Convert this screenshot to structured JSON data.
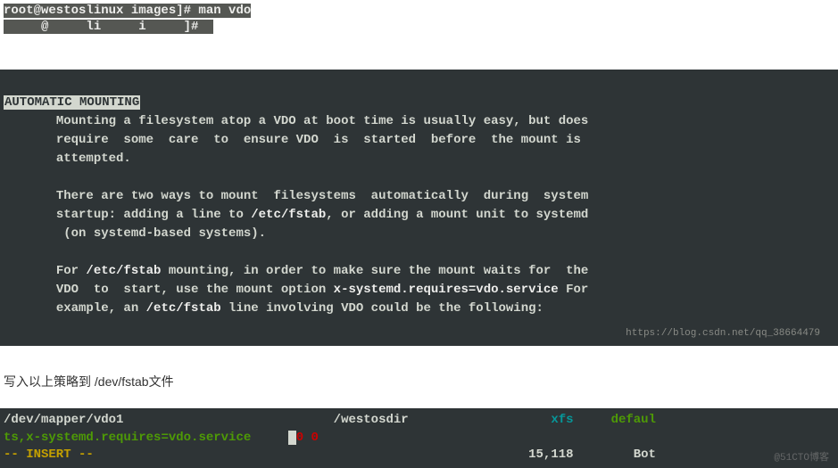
{
  "top": {
    "prompt": "root@westoslinux images]# man vdo",
    "second": "     @     li     i     ]#  "
  },
  "man": {
    "heading": "AUTOMATIC MOUNTING",
    "para1_l1": "       Mounting a filesystem atop a VDO at boot time is usually easy, but does",
    "para1_l2": "       require  some  care  to  ensure VDO  is  started  before  the mount is",
    "para1_l3": "       attempted.",
    "para2_l1": "       There are two ways to mount  filesystems  automatically  during  system",
    "para2_l2a": "       startup: adding a line to ",
    "path_fstab": "/etc/fstab",
    "para2_l2b": ", or adding a mount unit to systemd",
    "para2_l3": "        (on systemd-based systems).",
    "para3_l1a": "       For ",
    "para3_l1b": " mounting, in order to make sure the mount waits for  the",
    "para3_l2a": "       VDO  to  start, use the mount option ",
    "mount_opt": "x-systemd.requires=vdo.service",
    "para3_l2b": " For",
    "para3_l3a": "       example, an ",
    "para3_l3b": " line involving VDO could be the following:",
    "watermark": "https://blog.csdn.net/qq_38664479"
  },
  "instruction": "写入以上策略到 /dev/fstab文件",
  "vim": {
    "device": "/dev/mapper/vdo1",
    "mountpoint": "/westosdir",
    "fstype": "xfs",
    "opts_end": "defaul",
    "line2_start": "ts,",
    "line2_opts": "x-systemd.requires=vdo.service",
    "dump": "0",
    "pass": " 0",
    "mode": "-- INSERT --",
    "pos": "15,118",
    "loc": "Bot",
    "watermark": "@51CTO博客"
  }
}
